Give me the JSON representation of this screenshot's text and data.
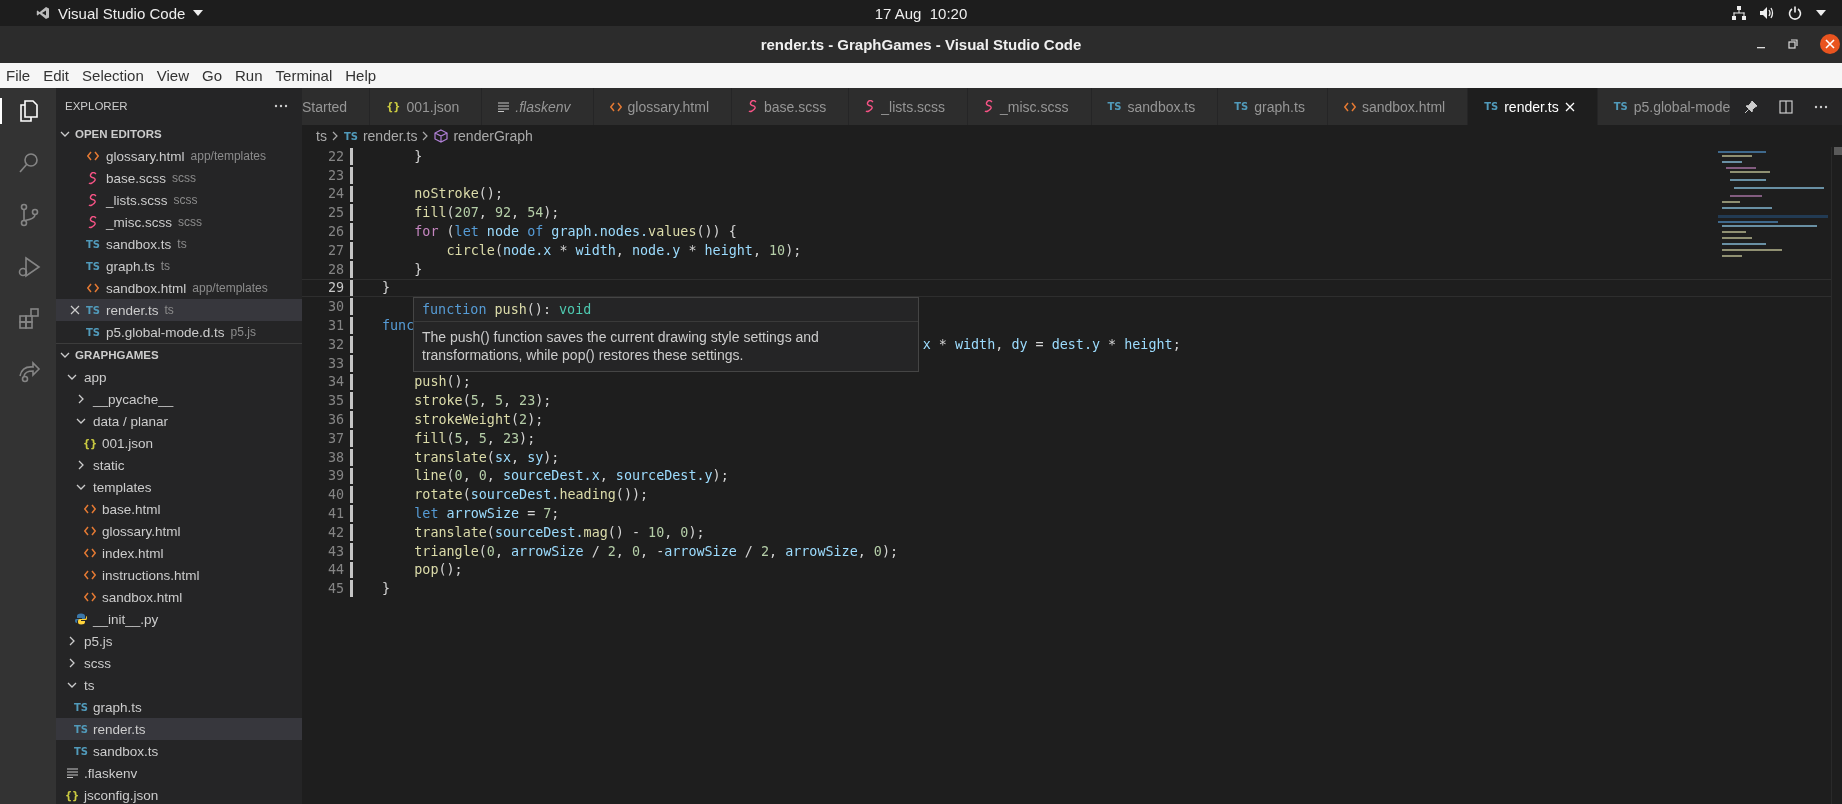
{
  "system_bar": {
    "app": "Visual Studio Code",
    "clock": "17 Aug  10:20"
  },
  "window": {
    "title": "render.ts - GraphGames - Visual Studio Code"
  },
  "menu": [
    "File",
    "Edit",
    "Selection",
    "View",
    "Go",
    "Run",
    "Terminal",
    "Help"
  ],
  "activity_bar": [
    {
      "kind": "explorer",
      "selected": true
    },
    {
      "kind": "search",
      "selected": false
    },
    {
      "kind": "source-control",
      "selected": false
    },
    {
      "kind": "run",
      "selected": false
    },
    {
      "kind": "extensions",
      "selected": false
    },
    {
      "kind": "remote",
      "selected": false
    }
  ],
  "sidebar": {
    "title": "EXPLORER",
    "open_editors": {
      "title": "OPEN EDITORS",
      "expanded": true,
      "items": [
        {
          "name": "glossary.html",
          "desc": "app/templates",
          "kind": "html",
          "selected": false
        },
        {
          "name": "base.scss",
          "desc": "scss",
          "kind": "scss",
          "selected": false
        },
        {
          "name": "_lists.scss",
          "desc": "scss",
          "kind": "scss",
          "selected": false
        },
        {
          "name": "_misc.scss",
          "desc": "scss",
          "kind": "scss",
          "selected": false
        },
        {
          "name": "sandbox.ts",
          "desc": "ts",
          "kind": "ts",
          "glyph": "TS",
          "selected": false
        },
        {
          "name": "graph.ts",
          "desc": "ts",
          "kind": "ts",
          "glyph": "TS",
          "selected": false
        },
        {
          "name": "sandbox.html",
          "desc": "app/templates",
          "kind": "html",
          "selected": false
        },
        {
          "name": "render.ts",
          "desc": "ts",
          "kind": "ts",
          "glyph": "TS",
          "selected": true
        },
        {
          "name": "p5.global-mode.d.ts",
          "desc": "p5.js",
          "kind": "ts",
          "glyph": "TS",
          "selected": false
        }
      ]
    },
    "workspace": {
      "title": "GRAPHGAMES",
      "expanded": true,
      "tree": [
        {
          "name": "app",
          "kind": "folder",
          "expanded": true,
          "selected": false,
          "children": [
            {
              "name": "__pycache__",
              "kind": "folder",
              "expanded": false,
              "selected": false
            },
            {
              "name": "data / planar",
              "kind": "folder",
              "expanded": true,
              "selected": false,
              "children": [
                {
                  "name": "001.json",
                  "kind": "json",
                  "glyph": "{}",
                  "selected": false
                }
              ]
            },
            {
              "name": "static",
              "kind": "folder",
              "expanded": false,
              "selected": false
            },
            {
              "name": "templates",
              "kind": "folder",
              "expanded": true,
              "selected": false,
              "children": [
                {
                  "name": "base.html",
                  "kind": "html",
                  "selected": false
                },
                {
                  "name": "glossary.html",
                  "kind": "html",
                  "selected": false
                },
                {
                  "name": "index.html",
                  "kind": "html",
                  "selected": false
                },
                {
                  "name": "instructions.html",
                  "kind": "html",
                  "selected": false
                },
                {
                  "name": "sandbox.html",
                  "kind": "html",
                  "selected": false
                }
              ]
            },
            {
              "name": "__init__.py",
              "kind": "py",
              "selected": false
            }
          ]
        },
        {
          "name": "p5.js",
          "kind": "folder",
          "expanded": false,
          "selected": false
        },
        {
          "name": "scss",
          "kind": "folder",
          "expanded": false,
          "selected": false
        },
        {
          "name": "ts",
          "kind": "folder",
          "expanded": true,
          "selected": false,
          "children": [
            {
              "name": "graph.ts",
              "kind": "ts",
              "glyph": "TS",
              "selected": false
            },
            {
              "name": "render.ts",
              "kind": "ts",
              "glyph": "TS",
              "selected": true
            },
            {
              "name": "sandbox.ts",
              "kind": "ts",
              "glyph": "TS",
              "selected": false
            }
          ]
        },
        {
          "name": ".flaskenv",
          "kind": "text",
          "selected": false
        },
        {
          "name": "jsconfig.json",
          "kind": "json",
          "glyph": "{}",
          "selected": false
        }
      ]
    }
  },
  "tabs": [
    {
      "label": "Started",
      "selected": false,
      "preview": false
    },
    {
      "label": "001.json",
      "kind": "json",
      "glyph": "{}",
      "selected": false,
      "preview": false
    },
    {
      "label": ".flaskenv",
      "kind": "text",
      "selected": false,
      "preview": true
    },
    {
      "label": "glossary.html",
      "kind": "html",
      "selected": false,
      "preview": false
    },
    {
      "label": "base.scss",
      "kind": "scss",
      "selected": false,
      "preview": false
    },
    {
      "label": "_lists.scss",
      "kind": "scss",
      "selected": false,
      "preview": false
    },
    {
      "label": "_misc.scss",
      "kind": "scss",
      "selected": false,
      "preview": false
    },
    {
      "label": "sandbox.ts",
      "kind": "ts",
      "glyph": "TS",
      "selected": false,
      "preview": false
    },
    {
      "label": "graph.ts",
      "kind": "ts",
      "glyph": "TS",
      "selected": false,
      "preview": false
    },
    {
      "label": "sandbox.html",
      "kind": "html",
      "selected": false,
      "preview": false
    },
    {
      "label": "render.ts",
      "kind": "ts",
      "glyph": "TS",
      "selected": true,
      "preview": false
    },
    {
      "label": "p5.global-mode",
      "kind": "ts",
      "glyph": "TS",
      "selected": false,
      "preview": false
    }
  ],
  "breadcrumb": [
    {
      "text": "ts"
    },
    {
      "text": "render.ts",
      "kind": "ts",
      "glyph": "TS"
    },
    {
      "text": "renderGraph",
      "kind": "symbol"
    }
  ],
  "editor": {
    "lines": [
      {
        "n": "22",
        "current": false,
        "tokens": [
          {
            "t": "    }",
            "kind": "plain"
          }
        ]
      },
      {
        "n": "23",
        "current": false
      },
      {
        "n": "24",
        "current": false,
        "tokens": [
          {
            "t": "    noStroke",
            "kind": "fn"
          },
          {
            "t": "();",
            "kind": "plain"
          }
        ]
      },
      {
        "n": "25",
        "current": false,
        "tokens": [
          {
            "t": "    fill",
            "kind": "fn"
          },
          {
            "t": "(",
            "kind": "plain"
          },
          {
            "t": "207",
            "kind": "num"
          },
          {
            "t": ", ",
            "kind": "plain"
          },
          {
            "t": "92",
            "kind": "num"
          },
          {
            "t": ", ",
            "kind": "plain"
          },
          {
            "t": "54",
            "kind": "num"
          },
          {
            "t": ");",
            "kind": "plain"
          }
        ]
      },
      {
        "n": "26",
        "current": false,
        "tokens": [
          {
            "t": "    for",
            "kind": "ctrl"
          },
          {
            "t": " (",
            "kind": "plain"
          },
          {
            "t": "let",
            "kind": "kw"
          },
          {
            "t": " node ",
            "kind": "var"
          },
          {
            "t": "of",
            "kind": "kw"
          },
          {
            "t": " graph.nodes.",
            "kind": "var"
          },
          {
            "t": "values",
            "kind": "fn"
          },
          {
            "t": "()) {",
            "kind": "plain"
          }
        ]
      },
      {
        "n": "27",
        "current": false,
        "tokens": [
          {
            "t": "        circle",
            "kind": "fn"
          },
          {
            "t": "(",
            "kind": "plain"
          },
          {
            "t": "node.x",
            "kind": "var"
          },
          {
            "t": " * ",
            "kind": "plain"
          },
          {
            "t": "width",
            "kind": "var"
          },
          {
            "t": ", ",
            "kind": "plain"
          },
          {
            "t": "node.y",
            "kind": "var"
          },
          {
            "t": " * ",
            "kind": "plain"
          },
          {
            "t": "height",
            "kind": "var"
          },
          {
            "t": ", ",
            "kind": "plain"
          },
          {
            "t": "10",
            "kind": "num"
          },
          {
            "t": ");",
            "kind": "plain"
          }
        ]
      },
      {
        "n": "28",
        "current": false,
        "tokens": [
          {
            "t": "    }",
            "kind": "plain"
          }
        ]
      },
      {
        "n": "29",
        "current": true,
        "tokens": [
          {
            "t": "}",
            "kind": "plain"
          }
        ]
      },
      {
        "n": "30",
        "current": false
      },
      {
        "n": "31",
        "current": false,
        "tokens": [
          {
            "t": "func",
            "kind": "kw"
          }
        ]
      },
      {
        "n": "32",
        "current": false,
        "tokens": [
          {
            "t": "                                                                   x",
            "kind": "var"
          },
          {
            "t": " * ",
            "kind": "plain"
          },
          {
            "t": "width",
            "kind": "var"
          },
          {
            "t": ", ",
            "kind": "plain"
          },
          {
            "t": "dy",
            "kind": "var"
          },
          {
            "t": " = ",
            "kind": "plain"
          },
          {
            "t": "dest.y",
            "kind": "var"
          },
          {
            "t": " * ",
            "kind": "plain"
          },
          {
            "t": "height",
            "kind": "var"
          },
          {
            "t": ";",
            "kind": "plain"
          }
        ]
      },
      {
        "n": "33",
        "current": false
      },
      {
        "n": "34",
        "current": false,
        "tokens": [
          {
            "t": "    push",
            "kind": "fn"
          },
          {
            "t": "();",
            "kind": "plain"
          }
        ]
      },
      {
        "n": "35",
        "current": false,
        "tokens": [
          {
            "t": "    stroke",
            "kind": "fn"
          },
          {
            "t": "(",
            "kind": "plain"
          },
          {
            "t": "5",
            "kind": "num"
          },
          {
            "t": ", ",
            "kind": "plain"
          },
          {
            "t": "5",
            "kind": "num"
          },
          {
            "t": ", ",
            "kind": "plain"
          },
          {
            "t": "23",
            "kind": "num"
          },
          {
            "t": ");",
            "kind": "plain"
          }
        ]
      },
      {
        "n": "36",
        "current": false,
        "tokens": [
          {
            "t": "    strokeWeight",
            "kind": "fn"
          },
          {
            "t": "(",
            "kind": "plain"
          },
          {
            "t": "2",
            "kind": "num"
          },
          {
            "t": ");",
            "kind": "plain"
          }
        ]
      },
      {
        "n": "37",
        "current": false,
        "tokens": [
          {
            "t": "    fill",
            "kind": "fn"
          },
          {
            "t": "(",
            "kind": "plain"
          },
          {
            "t": "5",
            "kind": "num"
          },
          {
            "t": ", ",
            "kind": "plain"
          },
          {
            "t": "5",
            "kind": "num"
          },
          {
            "t": ", ",
            "kind": "plain"
          },
          {
            "t": "23",
            "kind": "num"
          },
          {
            "t": ");",
            "kind": "plain"
          }
        ]
      },
      {
        "n": "38",
        "current": false,
        "tokens": [
          {
            "t": "    translate",
            "kind": "fn"
          },
          {
            "t": "(",
            "kind": "plain"
          },
          {
            "t": "sx",
            "kind": "var"
          },
          {
            "t": ", ",
            "kind": "plain"
          },
          {
            "t": "sy",
            "kind": "var"
          },
          {
            "t": ");",
            "kind": "plain"
          }
        ]
      },
      {
        "n": "39",
        "current": false,
        "tokens": [
          {
            "t": "    line",
            "kind": "fn"
          },
          {
            "t": "(",
            "kind": "plain"
          },
          {
            "t": "0",
            "kind": "num"
          },
          {
            "t": ", ",
            "kind": "plain"
          },
          {
            "t": "0",
            "kind": "num"
          },
          {
            "t": ", ",
            "kind": "plain"
          },
          {
            "t": "sourceDest.x",
            "kind": "var"
          },
          {
            "t": ", ",
            "kind": "plain"
          },
          {
            "t": "sourceDest.y",
            "kind": "var"
          },
          {
            "t": ");",
            "kind": "plain"
          }
        ]
      },
      {
        "n": "40",
        "current": false,
        "tokens": [
          {
            "t": "    rotate",
            "kind": "fn"
          },
          {
            "t": "(",
            "kind": "plain"
          },
          {
            "t": "sourceDest.",
            "kind": "var"
          },
          {
            "t": "heading",
            "kind": "fn"
          },
          {
            "t": "());",
            "kind": "plain"
          }
        ]
      },
      {
        "n": "41",
        "current": false,
        "tokens": [
          {
            "t": "    let",
            "kind": "kw"
          },
          {
            "t": " arrowSize",
            "kind": "var"
          },
          {
            "t": " = ",
            "kind": "plain"
          },
          {
            "t": "7",
            "kind": "num"
          },
          {
            "t": ";",
            "kind": "plain"
          }
        ]
      },
      {
        "n": "42",
        "current": false,
        "tokens": [
          {
            "t": "    translate",
            "kind": "fn"
          },
          {
            "t": "(",
            "kind": "plain"
          },
          {
            "t": "sourceDest.",
            "kind": "var"
          },
          {
            "t": "mag",
            "kind": "fn"
          },
          {
            "t": "() - ",
            "kind": "plain"
          },
          {
            "t": "10",
            "kind": "num"
          },
          {
            "t": ", ",
            "kind": "plain"
          },
          {
            "t": "0",
            "kind": "num"
          },
          {
            "t": ");",
            "kind": "plain"
          }
        ]
      },
      {
        "n": "43",
        "current": false,
        "tokens": [
          {
            "t": "    triangle",
            "kind": "fn"
          },
          {
            "t": "(",
            "kind": "plain"
          },
          {
            "t": "0",
            "kind": "num"
          },
          {
            "t": ", ",
            "kind": "plain"
          },
          {
            "t": "arrowSize",
            "kind": "var"
          },
          {
            "t": " / ",
            "kind": "plain"
          },
          {
            "t": "2",
            "kind": "num"
          },
          {
            "t": ", ",
            "kind": "plain"
          },
          {
            "t": "0",
            "kind": "num"
          },
          {
            "t": ", -",
            "kind": "plain"
          },
          {
            "t": "arrowSize",
            "kind": "var"
          },
          {
            "t": " / ",
            "kind": "plain"
          },
          {
            "t": "2",
            "kind": "num"
          },
          {
            "t": ", ",
            "kind": "plain"
          },
          {
            "t": "arrowSize",
            "kind": "var"
          },
          {
            "t": ", ",
            "kind": "plain"
          },
          {
            "t": "0",
            "kind": "num"
          },
          {
            "t": ");",
            "kind": "plain"
          }
        ]
      },
      {
        "n": "44",
        "current": false,
        "tokens": [
          {
            "t": "    pop",
            "kind": "fn"
          },
          {
            "t": "();",
            "kind": "plain"
          }
        ]
      },
      {
        "n": "45",
        "current": false,
        "tokens": [
          {
            "t": "}",
            "kind": "plain"
          }
        ]
      }
    ],
    "hover": {
      "signature": [
        {
          "t": "function",
          "kind": "kw"
        },
        {
          "t": " push",
          "kind": "fn"
        },
        {
          "t": "(): ",
          "kind": "plain"
        },
        {
          "t": "void",
          "kind": "type"
        }
      ],
      "doc": "The push() function saves the current drawing style settings and transformations, while pop() restores these settings."
    }
  }
}
